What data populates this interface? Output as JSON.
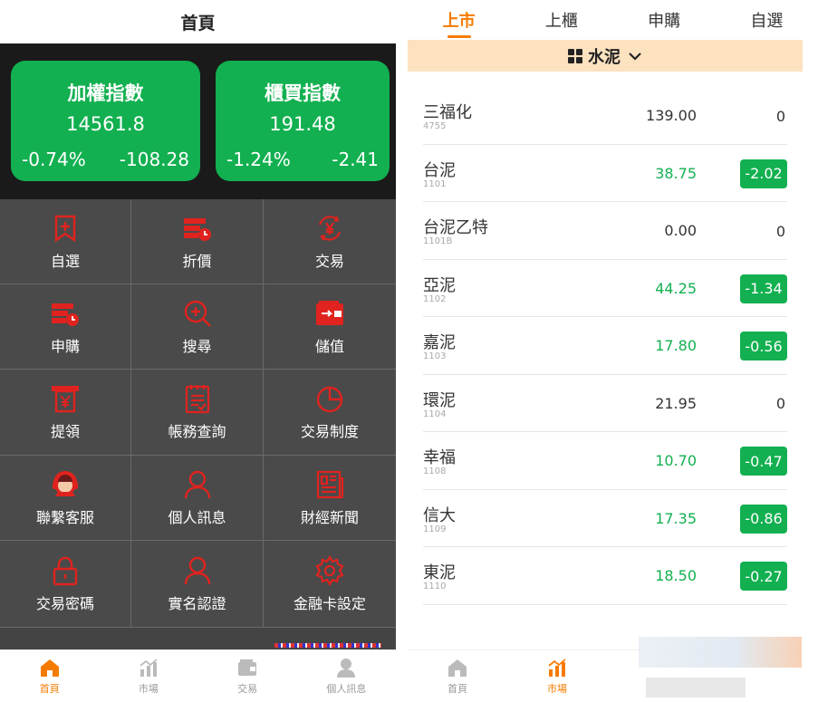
{
  "left": {
    "title": "首頁",
    "indices": [
      {
        "name": "加權指數",
        "value": "14561.8",
        "pct": "-0.74%",
        "change": "-108.28"
      },
      {
        "name": "櫃買指數",
        "value": "191.48",
        "pct": "-1.24%",
        "change": "-2.41"
      }
    ],
    "menu": [
      {
        "label": "自選",
        "icon": "bookmark-plus-icon"
      },
      {
        "label": "折價",
        "icon": "discount-stack-icon"
      },
      {
        "label": "交易",
        "icon": "yen-exchange-icon"
      },
      {
        "label": "申購",
        "icon": "subscribe-stack-icon"
      },
      {
        "label": "搜尋",
        "icon": "search-icon"
      },
      {
        "label": "儲值",
        "icon": "wallet-icon"
      },
      {
        "label": "提領",
        "icon": "atm-withdraw-icon"
      },
      {
        "label": "帳務查詢",
        "icon": "ledger-icon"
      },
      {
        "label": "交易制度",
        "icon": "pie-chart-icon"
      },
      {
        "label": "聯繫客服",
        "icon": "customer-service-icon"
      },
      {
        "label": "個人訊息",
        "icon": "user-icon"
      },
      {
        "label": "財經新聞",
        "icon": "newspaper-icon"
      },
      {
        "label": "交易密碼",
        "icon": "lock-icon"
      },
      {
        "label": "實名認證",
        "icon": "user-verify-icon"
      },
      {
        "label": "金融卡設定",
        "icon": "gear-icon"
      }
    ],
    "tabs": [
      {
        "label": "首頁",
        "icon": "home-icon",
        "active": true
      },
      {
        "label": "市場",
        "icon": "market-chart-icon",
        "active": false
      },
      {
        "label": "交易",
        "icon": "wallet-icon",
        "active": false
      },
      {
        "label": "個人訊息",
        "icon": "user-icon",
        "active": false
      }
    ]
  },
  "right": {
    "market_tabs": [
      {
        "label": "上市",
        "active": true
      },
      {
        "label": "上櫃",
        "active": false
      },
      {
        "label": "申購",
        "active": false
      },
      {
        "label": "自選",
        "active": false
      }
    ],
    "category": "水泥",
    "stocks": [
      {
        "name": "三福化",
        "code": "4755",
        "price": "139.00",
        "change": "0",
        "down": false
      },
      {
        "name": "台泥",
        "code": "1101",
        "price": "38.75",
        "change": "-2.02",
        "down": true
      },
      {
        "name": "台泥乙特",
        "code": "1101B",
        "price": "0.00",
        "change": "0",
        "down": false
      },
      {
        "name": "亞泥",
        "code": "1102",
        "price": "44.25",
        "change": "-1.34",
        "down": true
      },
      {
        "name": "嘉泥",
        "code": "1103",
        "price": "17.80",
        "change": "-0.56",
        "down": true
      },
      {
        "name": "環泥",
        "code": "1104",
        "price": "21.95",
        "change": "0",
        "down": false
      },
      {
        "name": "幸福",
        "code": "1108",
        "price": "10.70",
        "change": "-0.47",
        "down": true
      },
      {
        "name": "信大",
        "code": "1109",
        "price": "17.35",
        "change": "-0.86",
        "down": true
      },
      {
        "name": "東泥",
        "code": "1110",
        "price": "18.50",
        "change": "-0.27",
        "down": true
      }
    ],
    "tabs": [
      {
        "label": "首頁",
        "icon": "home-icon",
        "active": false
      },
      {
        "label": "市場",
        "icon": "market-chart-icon",
        "active": true
      }
    ]
  },
  "colors": {
    "green": "#12b050",
    "orange": "#f57b00",
    "icon_red": "#e0231e",
    "grid_bg": "#4a4a4a"
  }
}
